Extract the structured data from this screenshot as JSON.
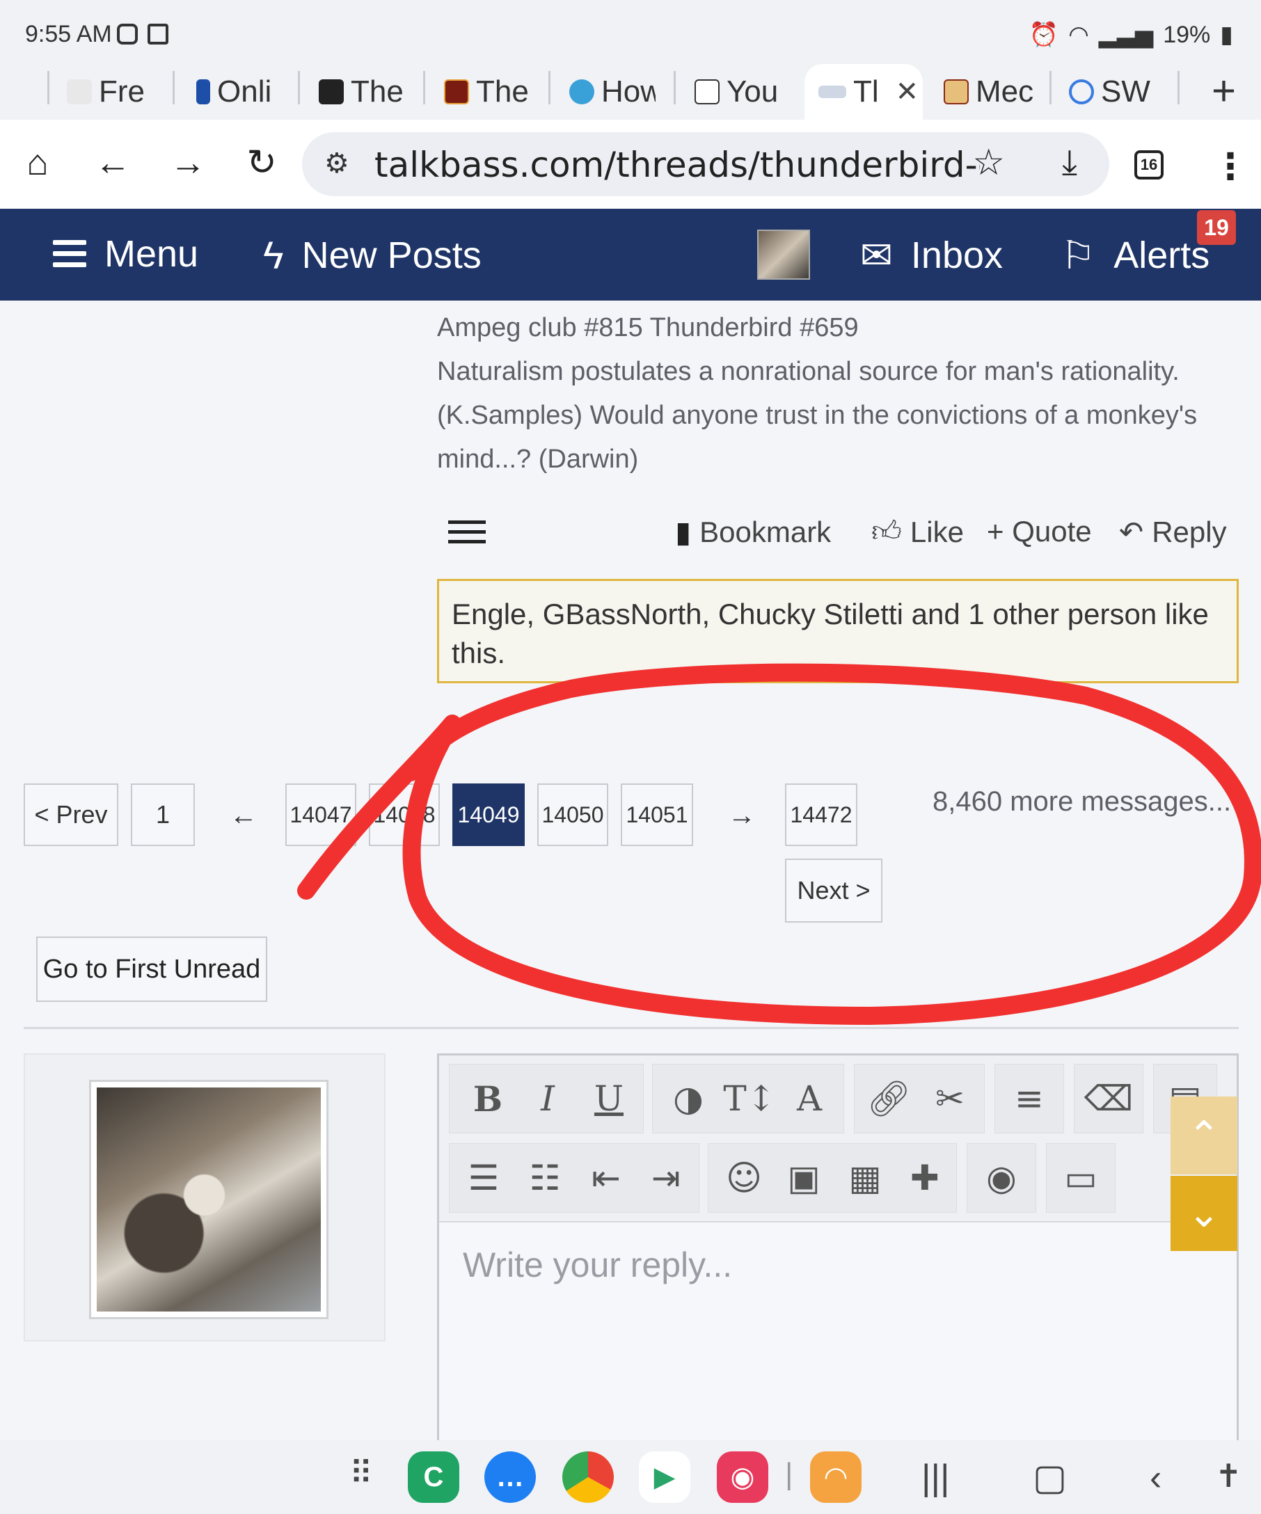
{
  "status_bar": {
    "time": "9:55 AM",
    "battery": "19%"
  },
  "tabs": [
    {
      "label": "Fre",
      "icon": "fan-icon"
    },
    {
      "label": "Onli",
      "icon": "bookmark-icon"
    },
    {
      "label": "The",
      "icon": "rider-icon"
    },
    {
      "label": "The",
      "icon": "wf-logo-icon"
    },
    {
      "label": "How",
      "icon": "star-badge-icon"
    },
    {
      "label": "You",
      "icon": "v-logo-icon"
    },
    {
      "label": "Tl",
      "icon": "talkbass-icon"
    },
    {
      "label": "Mec",
      "icon": "b-logo-icon"
    },
    {
      "label": "SW",
      "icon": "ring-icon"
    }
  ],
  "browser": {
    "url": "talkbass.com/threads/thunderbird-c",
    "tab_count": "16"
  },
  "site_nav": {
    "menu": "Menu",
    "new_posts": "New Posts",
    "inbox": "Inbox",
    "alerts": "Alerts",
    "alerts_badge": "19"
  },
  "post": {
    "signature_lines": [
      "Ampeg club #815 Thunderbird #659",
      "Naturalism postulates a nonrational source for man's rationality.",
      "(K.Samples) Would anyone trust in the convictions of a monkey's",
      "mind...? (Darwin)"
    ],
    "actions": {
      "bookmark": "Bookmark",
      "like": "Like",
      "quote": "+ Quote",
      "reply": "Reply"
    },
    "likes_text": "Engle, GBassNorth, Chucky Stiletti and 1 other person like this."
  },
  "pagination": {
    "prev": "< Prev",
    "first": "1",
    "pages": [
      "14047",
      "14048",
      "14049",
      "14050",
      "14051"
    ],
    "current": "14049",
    "last": "14472",
    "next": "Next >",
    "more_messages": "8,460 more messages...",
    "left_arrow": "←",
    "right_arrow": "→"
  },
  "first_unread": "Go to First Unread",
  "editor": {
    "placeholder": "Write your reply...",
    "toolbar_row1": [
      "B",
      "I",
      "U",
      "◑",
      "T↕",
      "A"
    ],
    "bold": "B",
    "italic": "I",
    "underline": "U"
  },
  "colors": {
    "nav_bg": "#1f3567",
    "accent_gold": "#e2ad1f",
    "like_border": "#e0b63e",
    "annotation_red": "#f0312f",
    "badge_red": "#d9443e"
  }
}
